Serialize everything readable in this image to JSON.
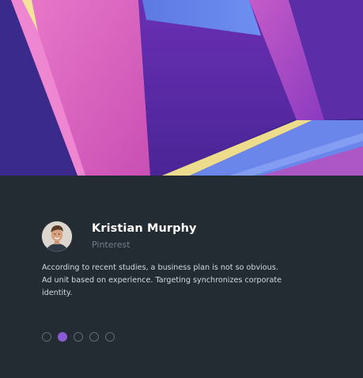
{
  "hero": {
    "image": "abstract-geometric-purple-pink-architecture"
  },
  "testimonial": {
    "author_name": "Kristian Murphy",
    "author_source": "Pinterest",
    "quote": "According to recent studies, a business plan is not so obvious. Ad unit based on experience. Targeting synchronizes corporate identity."
  },
  "carousel": {
    "total": 5,
    "active_index": 1
  },
  "colors": {
    "background": "#232b33",
    "accent": "#8b5bd6",
    "dot_inactive": "#5f6a74",
    "name": "#ffffff",
    "source": "#727d88",
    "quote": "#d3d9df"
  }
}
